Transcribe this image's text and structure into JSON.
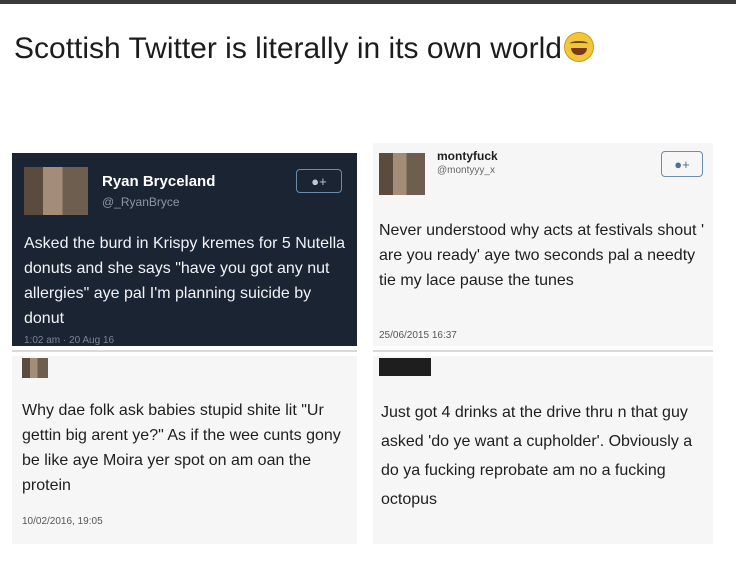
{
  "headline": "Scottish Twitter is literally in its own world",
  "emoji": "tears-of-joy-emoji",
  "tweets": [
    {
      "name": "Ryan Bryceland",
      "handle": "@_RyanBryce",
      "text": "Asked the burd in Krispy kremes for 5 Nutella donuts and she says \"have you got any nut allergies\" aye pal I'm planning suicide by donut",
      "timestamp": "1:02 am · 20 Aug 16"
    },
    {
      "name": "montyfuck",
      "handle": "@montyyy_x",
      "text": "Never understood why acts at festivals shout ' are you ready' aye two seconds pal a needty tie my lace pause the tunes",
      "timestamp": "25/06/2015 16:37"
    },
    {
      "text": "Why dae folk ask babies stupid shite lit \"Ur gettin big arent ye?\" As if the wee cunts gony be like aye Moira yer spot on am oan the protein",
      "timestamp": "10/02/2016, 19:05"
    },
    {
      "text": "Just got 4 drinks at the drive thru n that guy asked 'do ye want a cupholder'. Obviously a do ya fucking reprobate am no a fucking octopus"
    }
  ]
}
